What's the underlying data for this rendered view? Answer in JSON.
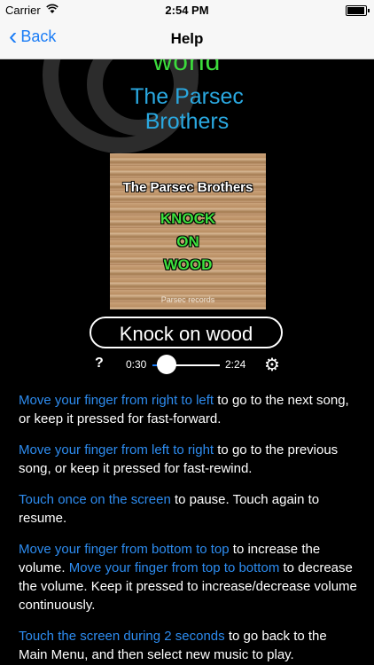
{
  "status": {
    "carrier": "Carrier",
    "time": "2:54 PM",
    "battery_level": 0.95
  },
  "nav": {
    "back_label": "Back",
    "title": "Help"
  },
  "art": {
    "top_word": "world",
    "artist_line1": "The Parsec",
    "artist_line2": "Brothers"
  },
  "album": {
    "artist": "The Parsec Brothers",
    "title_lines": [
      "KNOCK",
      "ON",
      "WOOD"
    ],
    "label": "Parsec records"
  },
  "song": {
    "title": "Knock on wood"
  },
  "player": {
    "help": "?",
    "elapsed": "0:30",
    "duration": "2:24",
    "progress": 0.21
  },
  "help": [
    {
      "link": "Move your finger from right to left",
      "rest": " to go to the next song, or keep it pressed for fast-forward."
    },
    {
      "link": "Move your finger from left to right",
      "rest": " to go to the previous song, or keep it pressed for fast-rewind."
    },
    {
      "link": "Touch once on the screen",
      "rest": " to pause. Touch again to resume."
    },
    {
      "link": "Move your finger from bottom to top",
      "rest": " to increase the volume. ",
      "link2": "Move your finger from top to bottom",
      "rest2": " to decrease the volume. Keep it pressed to increase/decrease volume continuously."
    },
    {
      "link": "Touch the screen during 2 seconds",
      "rest": " to go back to the Main Menu, and then select new music to play."
    }
  ],
  "colors": {
    "accent": "#1a7cf6",
    "highlight": "#2d8cf0",
    "artist": "#2aa8e0",
    "green": "#3cdc3c"
  }
}
